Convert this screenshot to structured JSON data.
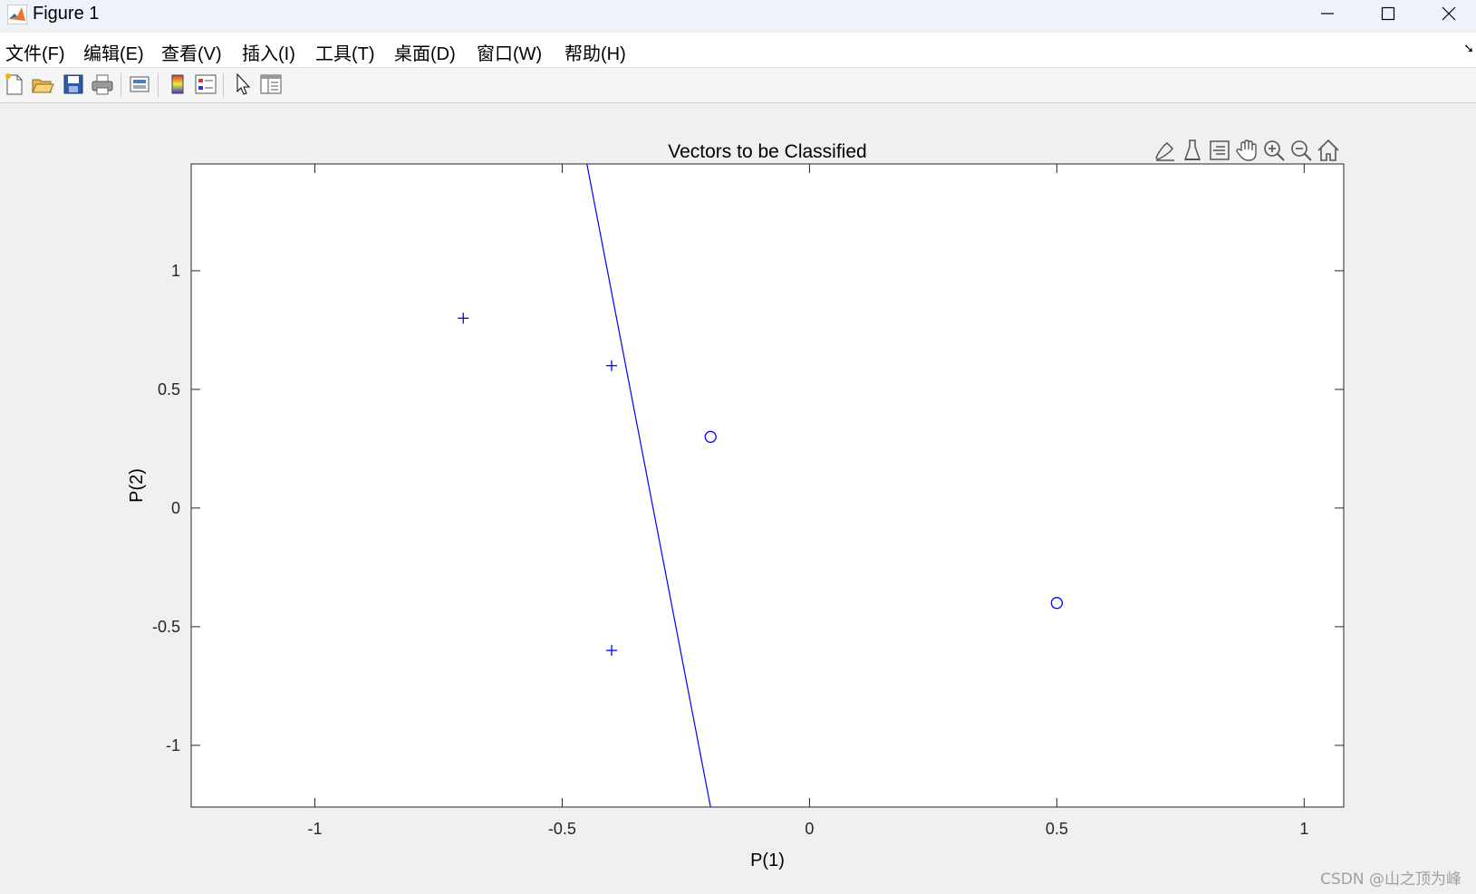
{
  "window": {
    "title": "Figure 1",
    "minimize_icon": "minimize-icon",
    "maximize_icon": "maximize-icon",
    "close_icon": "close-icon"
  },
  "menu": {
    "items": [
      "文件(F)",
      "编辑(E)",
      "查看(V)",
      "插入(I)",
      "工具(T)",
      "桌面(D)",
      "窗口(W)",
      "帮助(H)"
    ]
  },
  "toolbar": {
    "icons": [
      "new-figure-icon",
      "open-file-icon",
      "save-icon",
      "print-icon",
      "link-plot-icon",
      "colorbar-icon",
      "legend-icon",
      "edit-plot-arrow-icon",
      "property-inspector-icon"
    ]
  },
  "axes_toolbar": {
    "icons": [
      "brush-icon",
      "data-tips-icon",
      "restore-view-icon",
      "pan-hand-icon",
      "zoom-in-icon",
      "zoom-out-icon",
      "home-icon"
    ]
  },
  "watermark": "CSDN @山之顶为峰",
  "chart_data": {
    "type": "scatter",
    "title": "Vectors to be Classified",
    "xlabel": "P(1)",
    "ylabel": "P(2)",
    "xlim": [
      -1.25,
      1.08
    ],
    "ylim": [
      -1.26,
      1.45
    ],
    "xticks": [
      -1,
      -0.5,
      0,
      0.5,
      1
    ],
    "xtick_labels": [
      "-1",
      "-0.5",
      "0",
      "0.5",
      "1"
    ],
    "yticks": [
      -1,
      -0.5,
      0,
      0.5,
      1
    ],
    "ytick_labels": [
      "-1",
      "-0.5",
      "0",
      "0.5",
      "1"
    ],
    "grid": false,
    "color": "#0000ff",
    "series": [
      {
        "marker": "plus",
        "points": [
          [
            -0.7,
            0.8
          ],
          [
            -0.4,
            0.6
          ],
          [
            -0.4,
            -0.6
          ]
        ]
      },
      {
        "marker": "circle",
        "points": [
          [
            -0.2,
            0.3
          ],
          [
            0.5,
            -0.4
          ]
        ]
      }
    ],
    "decision_line": {
      "points": [
        [
          -0.45,
          1.45
        ],
        [
          -0.2,
          -1.26
        ]
      ]
    }
  }
}
